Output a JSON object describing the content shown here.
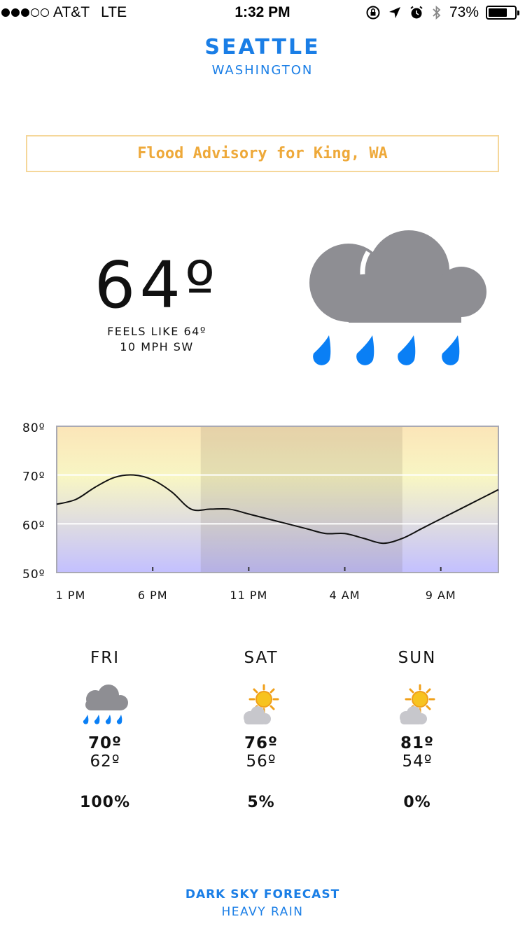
{
  "status_bar": {
    "carrier": "AT&T",
    "network": "LTE",
    "time": "1:32 PM",
    "battery_label": "73%",
    "battery_level": 0.73,
    "signal_bars_filled": 3,
    "signal_bars_total": 5,
    "icons": [
      "orientation-lock-icon",
      "location-arrow-icon",
      "alarm-icon",
      "bluetooth-icon"
    ]
  },
  "location": {
    "city": "SEATTLE",
    "state": "WASHINGTON"
  },
  "advisory": {
    "text": "Flood Advisory for King, WA",
    "border_color": "#f5d79a",
    "text_color": "#eea93a"
  },
  "current": {
    "temperature": "64º",
    "feels_like": "FEELS LIKE 64º",
    "wind": "10 MPH SW",
    "icon": "heavy-rain-icon"
  },
  "chart_data": {
    "type": "line",
    "x_labels": [
      "1 PM",
      "6 PM",
      "11 PM",
      "4 AM",
      "9 AM"
    ],
    "y_labels": [
      "80º",
      "70º",
      "60º",
      "50º"
    ],
    "ylim": [
      50,
      80
    ],
    "hours_span": 23,
    "x_ticks_hours": [
      0,
      5,
      10,
      15,
      20
    ],
    "grid": true,
    "night_band_hours": [
      7.5,
      18
    ],
    "series": [
      {
        "points": [
          [
            0,
            64
          ],
          [
            1,
            65
          ],
          [
            2,
            67.5
          ],
          [
            3,
            69.5
          ],
          [
            4,
            70
          ],
          [
            5,
            69
          ],
          [
            6,
            66.5
          ],
          [
            7,
            63
          ],
          [
            8,
            63
          ],
          [
            9,
            63
          ],
          [
            10,
            62
          ],
          [
            11,
            61
          ],
          [
            12,
            60
          ],
          [
            13,
            59
          ],
          [
            14,
            58
          ],
          [
            15,
            58
          ],
          [
            16,
            57
          ],
          [
            17,
            56
          ],
          [
            18,
            57
          ],
          [
            19,
            59
          ],
          [
            20,
            61
          ],
          [
            21,
            63
          ],
          [
            22,
            65
          ],
          [
            23,
            67
          ]
        ]
      }
    ],
    "colors": {
      "line": "#111111",
      "day_top": "#fbe5b8",
      "day_mid": "#f8f6c4",
      "day_bottom": "#c3c0ff",
      "night_overlay": "#5a4a3a"
    }
  },
  "forecast": [
    {
      "day": "FRI",
      "high": "70º",
      "low": "62º",
      "precip": "100%",
      "icon": "rain-icon"
    },
    {
      "day": "SAT",
      "high": "76º",
      "low": "56º",
      "precip": "5%",
      "icon": "partly-sunny-icon"
    },
    {
      "day": "SUN",
      "high": "81º",
      "low": "54º",
      "precip": "0%",
      "icon": "partly-sunny-icon"
    }
  ],
  "footer": {
    "title": "DARK SKY FORECAST",
    "subtitle": "HEAVY RAIN"
  },
  "colors": {
    "accent": "#1a7ee6",
    "cloud": "#8e8e93",
    "rain": "#0a7ff5",
    "sun": "#f5b21b"
  }
}
